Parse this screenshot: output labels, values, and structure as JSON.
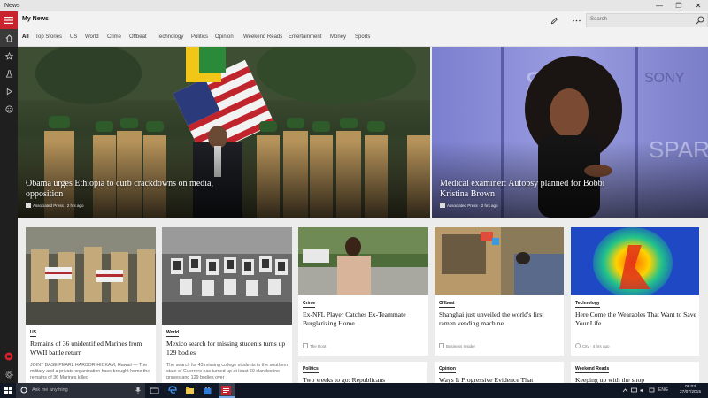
{
  "window": {
    "title": "News",
    "controls": [
      "—",
      "❐",
      "✕"
    ]
  },
  "header": {
    "app_title": "My News",
    "search_placeholder": "Search"
  },
  "tabs": [
    "All",
    "Top Stories",
    "US",
    "World",
    "Crime",
    "Offbeat",
    "Technology",
    "Politics",
    "Opinion",
    "Weekend Reads",
    "Entertainment",
    "Money",
    "Sports"
  ],
  "hero": [
    {
      "title": "Obama urges Ethiopia to curb crackdowns on media, opposition",
      "source": "Associated Press · 2 hrs ago"
    },
    {
      "title": "Medical examiner: Autopsy planned for Bobbi Kristina Brown",
      "source": "Associated Press · 2 hrs ago"
    }
  ],
  "cards": [
    {
      "category": "US",
      "title": "Remains of 36 unidentified Marines from WWII battle return",
      "desc": "JOINT BASE PEARL HARBOR-HICKAM, Hawaii — The military and a private organization have brought home the remains of 36 Marines killed"
    },
    {
      "category": "World",
      "title": "Mexico search for missing students turns up 129 bodies",
      "desc": "The search for 43 missing college students in the southern state of Guerrero has turned up at least 60 clandestine graves and 129 bodies over"
    },
    {
      "category": "Crime",
      "title": "Ex-NFL Player Catches Ex-Teammate Burglarizing Home",
      "source": "The Root"
    },
    {
      "category": "Offbeat",
      "title": "Shanghai just unveiled the world's first ramen vending machine",
      "source": "Business Insider"
    },
    {
      "category": "Technology",
      "title": "Here Come the Wearables That Want to Save Your Life",
      "source": "City · 4 hrs ago"
    }
  ],
  "mini_cards": [
    {
      "category": "Politics",
      "title": "Two weeks to go: Republicans"
    },
    {
      "category": "Opinion",
      "title": "Ways It Progressive Evidence That"
    },
    {
      "category": "Weekend Reads",
      "title": "Keeping up with the shop"
    }
  ],
  "taskbar": {
    "search_placeholder": "Ask me anything",
    "language": "ENG",
    "time": "09:03",
    "date": "27/07/2015"
  },
  "colors": {
    "accent": "#c8242e",
    "rail": "#1f1f1f",
    "taskbar": "#101826"
  }
}
